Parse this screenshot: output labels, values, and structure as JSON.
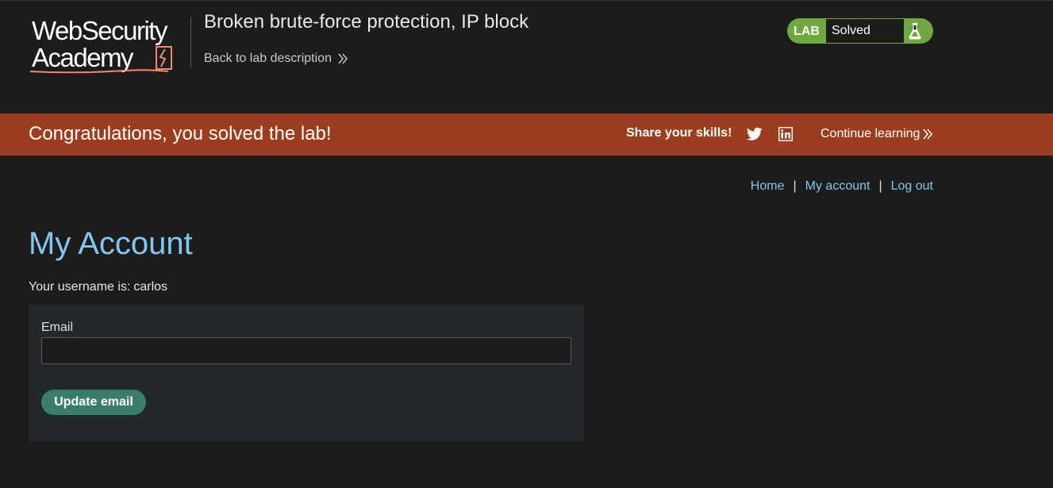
{
  "header": {
    "logo_text": "Web Security Academy",
    "lab_title": "Broken brute-force protection, IP block",
    "back_link": "Back to lab description"
  },
  "lab_status": {
    "label": "LAB",
    "value": "Solved",
    "color": "#70a840"
  },
  "banner": {
    "message": "Congratulations, you solved the lab!",
    "share_label": "Share your skills!",
    "continue_label": "Continue learning",
    "icons": [
      "twitter-icon",
      "linkedin-icon"
    ],
    "color": "#9b3e1f"
  },
  "nav": {
    "home": "Home",
    "my_account": "My account",
    "logout": "Log out",
    "separator": "|"
  },
  "main": {
    "title": "My Account",
    "username_label": "Your username is:",
    "username": "carlos",
    "email_label": "Email",
    "email_value": "",
    "update_button": "Update email"
  }
}
